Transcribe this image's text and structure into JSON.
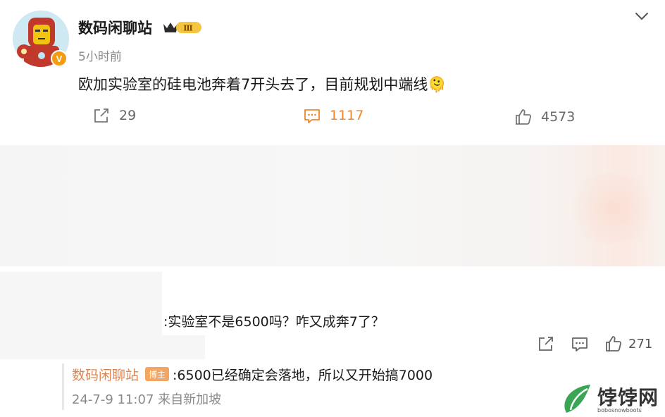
{
  "post": {
    "author": "数码闲聊站",
    "level_badge": "Ⅲ",
    "verified_mark": "V",
    "time": "5小时前",
    "text": "欧加实验室的硅电池奔着7开头去了，目前规划中端线🫠",
    "actions": {
      "share_count": "29",
      "comment_count": "1117",
      "like_count": "4573"
    },
    "icons": {
      "avatar": "iron-man-avatar",
      "more": "chevron-down-icon",
      "share": "share-icon",
      "comment": "comment-icon",
      "like": "thumbs-up-icon"
    }
  },
  "comment": {
    "text": ":实验室不是6500吗？咋又成奔7了？",
    "like_count": "271"
  },
  "reply": {
    "author": "数码闲聊站",
    "badge": "博主",
    "text": ":6500已经确定会落地，所以又开始搞7000",
    "meta": "24-7-9 11:07 来自新加坡"
  },
  "watermark": {
    "text": "饽饽网",
    "subtext": "bobosnowboots"
  },
  "colors": {
    "accent_orange": "#f0862a",
    "reply_author": "#e08550",
    "blogger_badge": "#f4a562"
  }
}
